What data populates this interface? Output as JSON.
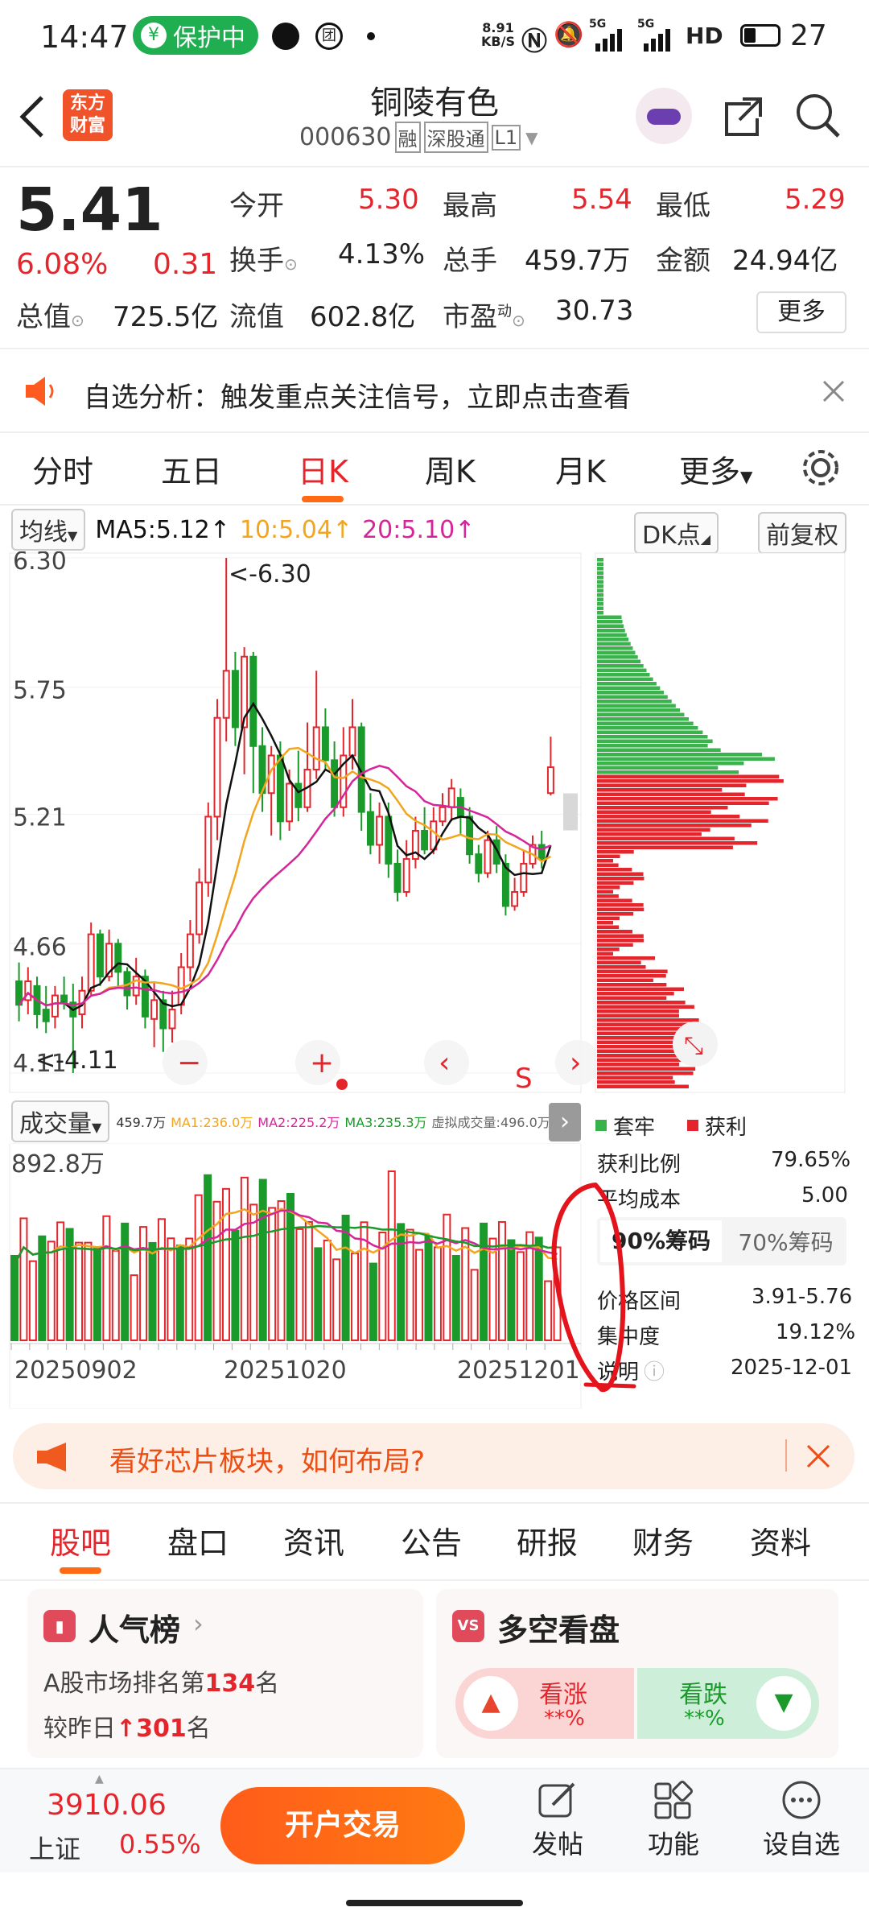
{
  "status": {
    "time": "14:47",
    "protect": "保护中",
    "net_speed_top": "8.91",
    "net_speed_bottom": "KB/S",
    "signal1": "5G",
    "signal2": "5G",
    "hd": "HD",
    "battery": "27"
  },
  "header": {
    "logo_top": "东方",
    "logo_bottom": "财富",
    "name": "铜陵有色",
    "code": "000630",
    "tag1": "融",
    "tag2": "深股通",
    "tag3": "L1"
  },
  "quote": {
    "price": "5.41",
    "pct": "6.08%",
    "chg": "0.31",
    "open_label": "今开",
    "open": "5.30",
    "high_label": "最高",
    "high": "5.54",
    "low_label": "最低",
    "low": "5.29",
    "turnover_label": "换手",
    "turnover": "4.13%",
    "vol_label": "总手",
    "vol": "459.7万",
    "amount_label": "金额",
    "amount": "24.94亿",
    "mcap_label": "总值",
    "mcap": "725.5亿",
    "float_label": "流值",
    "float": "602.8亿",
    "pe_label": "市盈",
    "pe_sup": "动",
    "pe": "30.73",
    "more": "更多"
  },
  "notice": {
    "text": "自选分析：触发重点关注信号，立即点击查看"
  },
  "tabs": [
    "分时",
    "五日",
    "日K",
    "周K",
    "月K",
    "更多"
  ],
  "active_tab": 2,
  "ma_bar": {
    "type": "均线",
    "ma5": "MA5:5.12↑",
    "ma10": "10:5.04↑",
    "ma20": "20:5.10↑",
    "dk": "DK点",
    "fq": "前复权"
  },
  "colors": {
    "up": "#e4262c",
    "down": "#1a9a2a",
    "ma5": "#111111",
    "ma10": "#f2a51f",
    "ma20": "#d4269a",
    "accent": "#ff6a13"
  },
  "price_axis": [
    "6.30",
    "5.75",
    "5.21",
    "4.66",
    "4.11"
  ],
  "annotations": {
    "high": "<-6.30",
    "low": "<-4.11",
    "s_mark": "S"
  },
  "vol_bar": {
    "type": "成交量",
    "total": "459.7万",
    "ma1": "MA1:236.0万",
    "ma2": "MA2:225.2万",
    "ma3": "MA3:235.3万",
    "virtual": "虚拟成交量:496.0万",
    "max": "892.8万"
  },
  "dates": [
    "20250902",
    "20251020",
    "20251201"
  ],
  "chips": {
    "legend_trapped": "套牢",
    "legend_profit": "获利",
    "profit_ratio_label": "获利比例",
    "profit_ratio": "79.65%",
    "avg_cost_label": "平均成本",
    "avg_cost": "5.00",
    "tab90": "90%筹码",
    "tab70": "70%筹码",
    "range_label": "价格区间",
    "range": "3.91-5.76",
    "conc_label": "集中度",
    "conc": "19.12%",
    "note_label": "说明",
    "note_date": "2025-12-01"
  },
  "ad": {
    "text": "看好芯片板块，如何布局?"
  },
  "bottom_tabs": [
    "股吧",
    "盘口",
    "资讯",
    "公告",
    "研报",
    "财务",
    "资料"
  ],
  "popularity": {
    "title": "人气榜",
    "line1_pre": "A股市场排名第",
    "line1_num": "134",
    "line1_post": "名",
    "line2_pre": "较昨日",
    "line2_arrow": "↑",
    "line2_num": "301",
    "line2_post": "名"
  },
  "sentiment": {
    "title": "多空看盘",
    "up": "看涨",
    "up_val": "**%",
    "down": "看跌",
    "down_val": "**%"
  },
  "footer": {
    "index_val": "3910.06",
    "index_name": "上证",
    "index_pct": "0.55%",
    "trade": "开户交易",
    "post": "发帖",
    "func": "功能",
    "watch": "设自选"
  },
  "chart_data": [
    {
      "type": "candlestick",
      "title": "日K",
      "y_axis_ticks": [
        6.3,
        5.75,
        5.21,
        4.66,
        4.11
      ],
      "ylim": [
        4.11,
        6.3
      ],
      "series_names": [
        "MA5:5.12",
        "10:5.04",
        "20:5.10"
      ],
      "last_close": 5.41,
      "last_open": 5.3,
      "last_high": 5.54,
      "last_low": 5.29,
      "marked_high": 6.3,
      "marked_low": 4.11
    },
    {
      "type": "bar",
      "title": "成交量",
      "y_max_label": "892.8万",
      "x_ticks": [
        "20250902",
        "20251020",
        "20251201"
      ]
    }
  ]
}
